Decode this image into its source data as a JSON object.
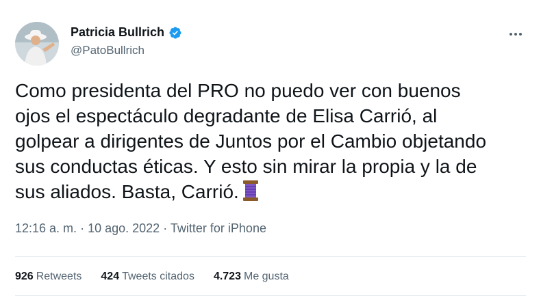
{
  "author": {
    "name": "Patricia Bullrich",
    "handle": "@PatoBullrich",
    "verified_color": "#1d9bf0"
  },
  "tweet": {
    "lines": [
      "Como presidenta del PRO no puedo ver con buenos",
      "ojos el espectáculo degradante de Elisa Carrió, al",
      "golpear a dirigentes de Juntos por el Cambio objetando",
      "sus conductas éticas. Y esto sin mirar la propia y la de",
      "sus aliados. Basta, Carrió."
    ],
    "emoji": "spool-of-thread"
  },
  "meta": {
    "time": "12:16 a. m.",
    "separator": "·",
    "date": "10 ago. 2022",
    "source": "Twitter for iPhone"
  },
  "stats": [
    {
      "count": "926",
      "label": "Retweets"
    },
    {
      "count": "424",
      "label": "Tweets citados"
    },
    {
      "count": "4.723",
      "label": "Me gusta"
    }
  ]
}
